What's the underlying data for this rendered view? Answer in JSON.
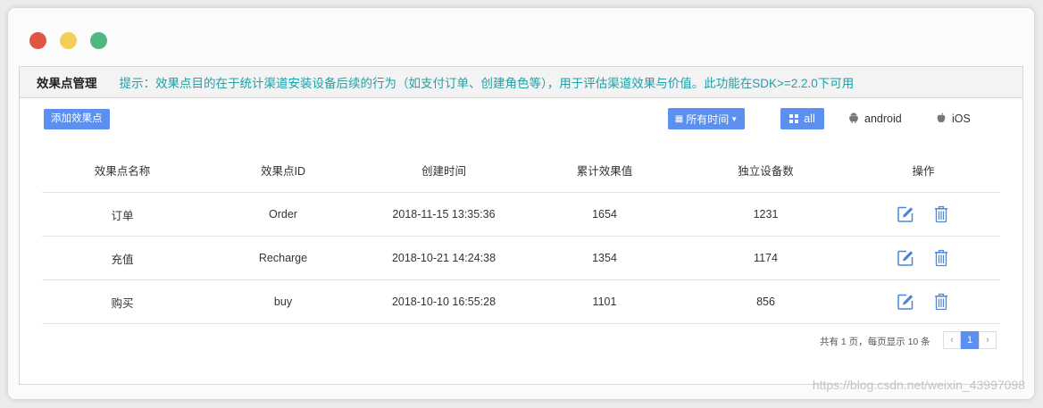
{
  "window": {
    "dot_colors": [
      "#e05543",
      "#f2cf5b",
      "#4eb883"
    ]
  },
  "header": {
    "title": "效果点管理",
    "tip": "提示：效果点目的在于统计渠道安装设备后续的行为（如支付订单、创建角色等），用于评估渠道效果与价值。此功能在SDK>=2.2.0下可用"
  },
  "toolbar": {
    "add_label": "添加效果点",
    "time_icon": "calendar-icon",
    "time_label": "所有时间",
    "all_label": "all",
    "android_label": "android",
    "ios_label": "iOS"
  },
  "table": {
    "columns": [
      "效果点名称",
      "效果点ID",
      "创建时间",
      "累计效果值",
      "独立设备数",
      "操作"
    ],
    "rows": [
      {
        "name": "订单",
        "id": "Order",
        "created": "2018-11-15 13:35:36",
        "total": "1654",
        "devices": "1231"
      },
      {
        "name": "充值",
        "id": "Recharge",
        "created": "2018-10-21 14:24:38",
        "total": "1354",
        "devices": "1174"
      },
      {
        "name": "购买",
        "id": "buy",
        "created": "2018-10-10 16:55:28",
        "total": "1101",
        "devices": "856"
      }
    ]
  },
  "pager": {
    "info": "共有 1 页，每页显示 10 条",
    "current_page": "1",
    "prev": "‹",
    "next": "›"
  },
  "watermark": "https://blog.csdn.net/weixin_43997098",
  "colors": {
    "accent": "#5b8ff0",
    "tip": "#1fa0a8"
  }
}
